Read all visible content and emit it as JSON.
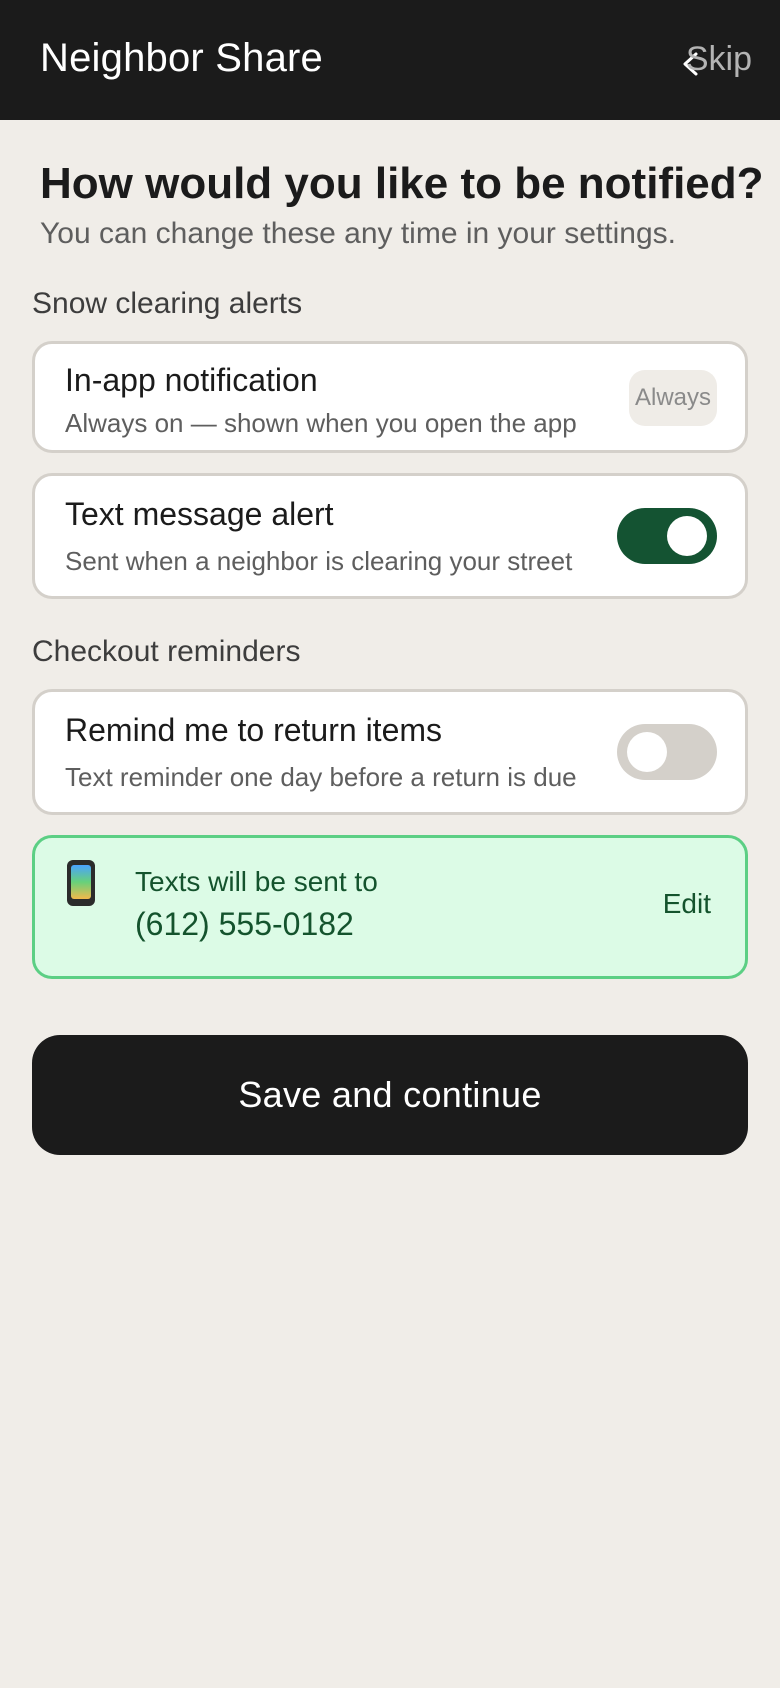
{
  "header": {
    "app_title": "Neighbor Share",
    "back_icon": "chevron-left-icon",
    "skip_label": "Skip"
  },
  "intro": {
    "heading": "How would you like to be notified?",
    "subheading": "You can change these any time in your settings."
  },
  "snow_section": {
    "label": "Snow clearing alerts",
    "in_app": {
      "title": "In-app notification",
      "description": "Always on — shown when you open the app",
      "badge": "Always"
    },
    "sms": {
      "title": "Text message alert",
      "description": "Sent when a neighbor is clearing your street",
      "enabled": true
    }
  },
  "checkout_section": {
    "label": "Checkout reminders",
    "remind": {
      "title": "Remind me to return items",
      "description": "Text reminder one day before a return is due",
      "enabled": false
    }
  },
  "phone": {
    "icon": "mobile-phone-icon",
    "label": "Texts will be sent to",
    "number": "(612) 555-0182",
    "edit_label": "Edit"
  },
  "actions": {
    "save_label": "Save and continue"
  },
  "colors": {
    "header_bg": "#1b1b1b",
    "page_bg": "#f0ede8",
    "toggle_on": "#145332",
    "toggle_off": "#d4d0ca",
    "phone_card_bg": "#dcfbe6",
    "phone_card_border": "#5ccf84"
  }
}
